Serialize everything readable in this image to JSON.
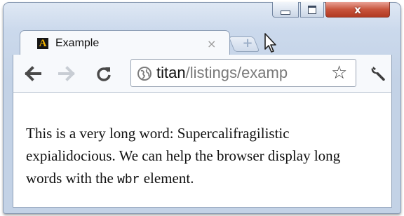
{
  "window": {
    "close_label": "x"
  },
  "tab": {
    "favicon_letter": "A",
    "title": "Example",
    "close_label": "×",
    "new_tab_label": "+"
  },
  "toolbar": {
    "back_icon": "back-arrow-icon",
    "forward_icon": "forward-arrow-icon",
    "reload_icon": "reload-icon",
    "star_label": "☆",
    "url_host": "titan",
    "url_path": "/listings/examp"
  },
  "content": {
    "text_before": "This is a very long word: Supercalifragilistic expialidocious. We can help the browser display long words with the ",
    "code": "wbr",
    "text_after": " element."
  }
}
